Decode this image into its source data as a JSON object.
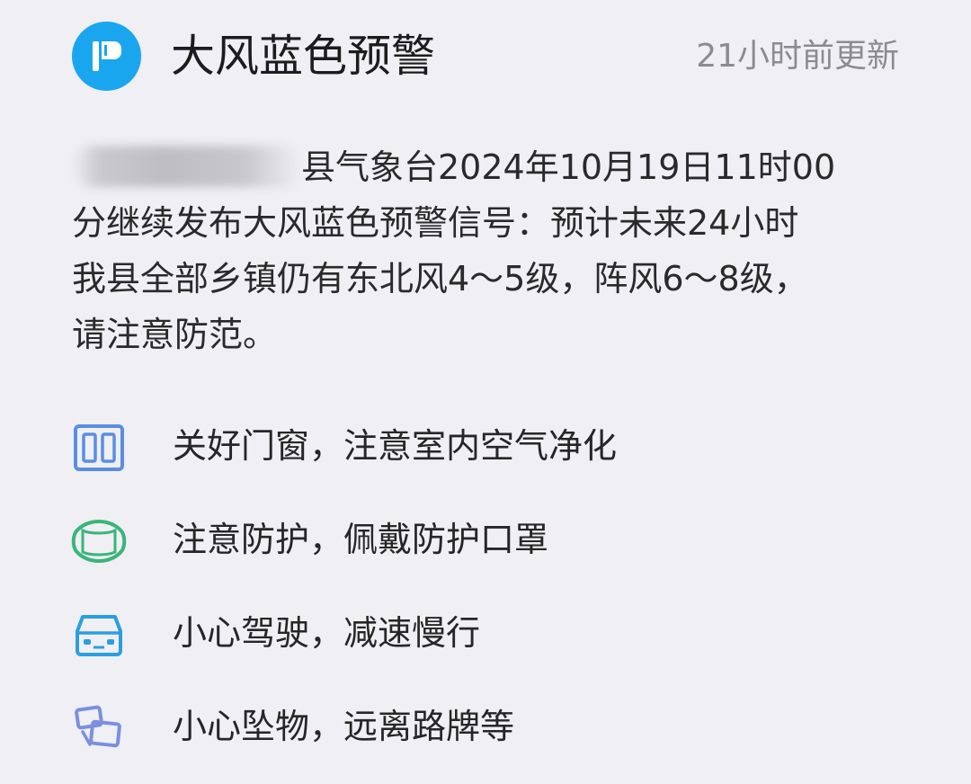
{
  "header": {
    "title": "大风蓝色预警",
    "updated": "21小时前更新",
    "logo_icon": "warning-flag-icon",
    "logo_color": "#1aa6ee"
  },
  "message": {
    "redacted_prefix": "",
    "lines": [
      "县气象台2024年10月19日11时00",
      "分继续发布大风蓝色预警信号：预计未来24小时",
      "我县全部乡镇仍有东北风4～5级，阵风6～8级，",
      "请注意防范。"
    ]
  },
  "tips": [
    {
      "icon": "window-icon",
      "color": "#5b8ee0",
      "label": "关好门窗，注意室内空气净化"
    },
    {
      "icon": "mask-icon",
      "color": "#3ab57a",
      "label": "注意防护，佩戴防护口罩"
    },
    {
      "icon": "car-icon",
      "color": "#2a9fe0",
      "label": "小心驾驶，减速慢行"
    },
    {
      "icon": "falling-objects-icon",
      "color": "#7b8fe0",
      "label": "小心坠物，远离路牌等"
    }
  ]
}
